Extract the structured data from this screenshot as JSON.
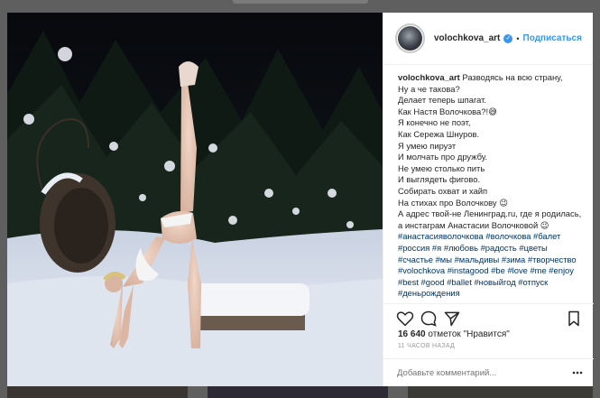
{
  "post": {
    "username": "volochkova_art",
    "verified_icon": "verified-badge-icon",
    "separator": "•",
    "follow_label": "Подписаться",
    "caption_user": "volochkova_art",
    "caption_text": " Разводясь на всю страну,\nНу а че такова?\nДелает теперь шпагат.\nКак Настя Волочкова?!😅\nЯ конечно не поэт,\nКак Сережа Шнуров.\nЯ умею пируэт\nИ молчать про дружбу.\nНе умею столько пить\nИ выглядеть фигово.\nСобирать охват и хайп\nНа стихах про Волочкову 😉\nА адрес твой-не Ленинград.ru, где я родилась, а инстаграм Анастасии Волочковой 😉 ",
    "caption_tags": "#анастасияволочкова #волочкова #балет #россия #я #любовь #радость #цветы #счастье #мы #мальдивы #зима #творчество #volochkova #instagood #be #love #me #enjoy #best #good #ballet #новыйгод #отпуск #деньрождения",
    "likes_count": "16 640",
    "likes_suffix": " отметок \"Нравится\"",
    "timestamp": "11 ЧАСОВ НАЗАД",
    "comment_placeholder": "Добавьте комментарий..."
  },
  "icons": {
    "like": "heart-icon",
    "comment": "comment-icon",
    "share": "share-icon",
    "save": "bookmark-icon",
    "options": "more-options-icon"
  },
  "colors": {
    "link": "#3897f0",
    "hashtag": "#003569",
    "muted": "#999999"
  }
}
